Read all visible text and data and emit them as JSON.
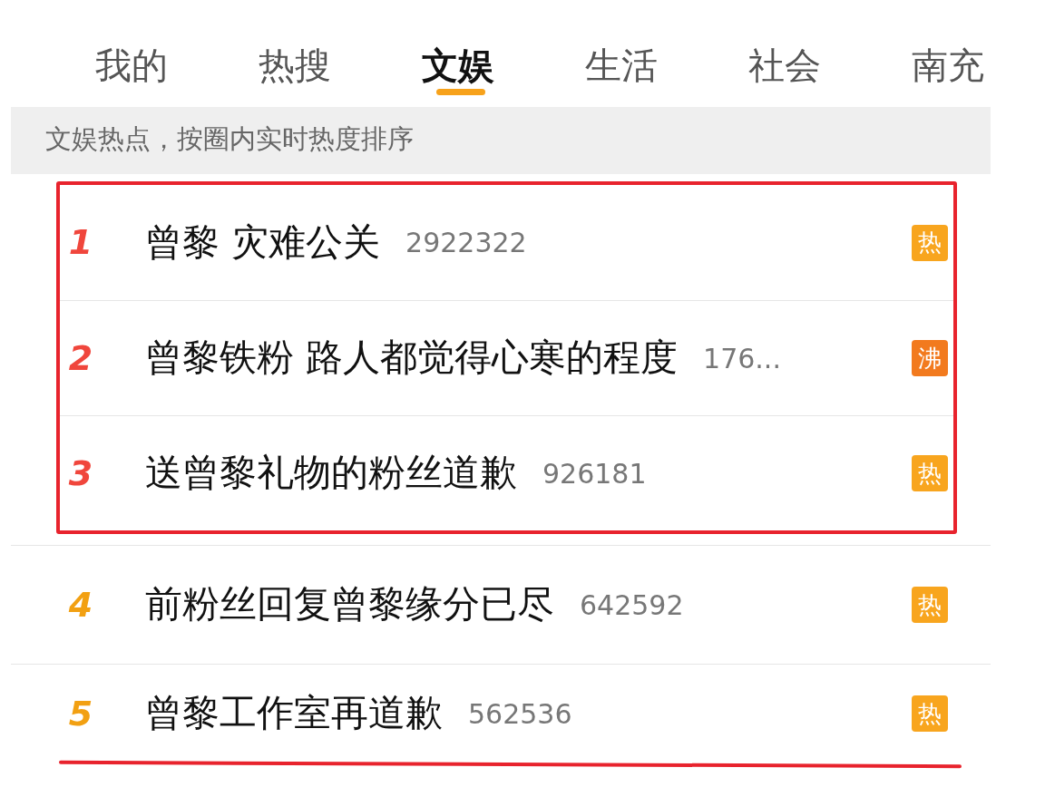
{
  "tabs": [
    {
      "label": "我的",
      "selected": false
    },
    {
      "label": "热搜",
      "selected": false
    },
    {
      "label": "文娱",
      "selected": true
    },
    {
      "label": "生活",
      "selected": false
    },
    {
      "label": "社会",
      "selected": false
    },
    {
      "label": "南充",
      "selected": false
    }
  ],
  "banner": "文娱热点，按圈内实时热度排序",
  "rows": [
    {
      "rank": "1",
      "color": "#f0463c",
      "title": "曾黎 灾难公关",
      "count": "2922322",
      "badge": {
        "text": "热",
        "kind": "hot"
      },
      "boxed": true,
      "underlined": false
    },
    {
      "rank": "2",
      "color": "#f0463c",
      "title": "曾黎铁粉 路人都觉得心寒的程度",
      "count": "176...",
      "badge": {
        "text": "沸",
        "kind": "boil"
      },
      "boxed": true,
      "underlined": false
    },
    {
      "rank": "3",
      "color": "#f0463c",
      "title": "送曾黎礼物的粉丝道歉",
      "count": "926181",
      "badge": {
        "text": "热",
        "kind": "hot"
      },
      "boxed": true,
      "underlined": false
    },
    {
      "rank": "4",
      "color": "#f2a012",
      "title": "前粉丝回复曾黎缘分已尽",
      "count": "642592",
      "badge": {
        "text": "热",
        "kind": "hot"
      },
      "boxed": false,
      "underlined": false
    },
    {
      "rank": "5",
      "color": "#f2a012",
      "title": "曾黎工作室再道歉",
      "count": "562536",
      "badge": {
        "text": "热",
        "kind": "hot"
      },
      "boxed": false,
      "underlined": true
    }
  ]
}
